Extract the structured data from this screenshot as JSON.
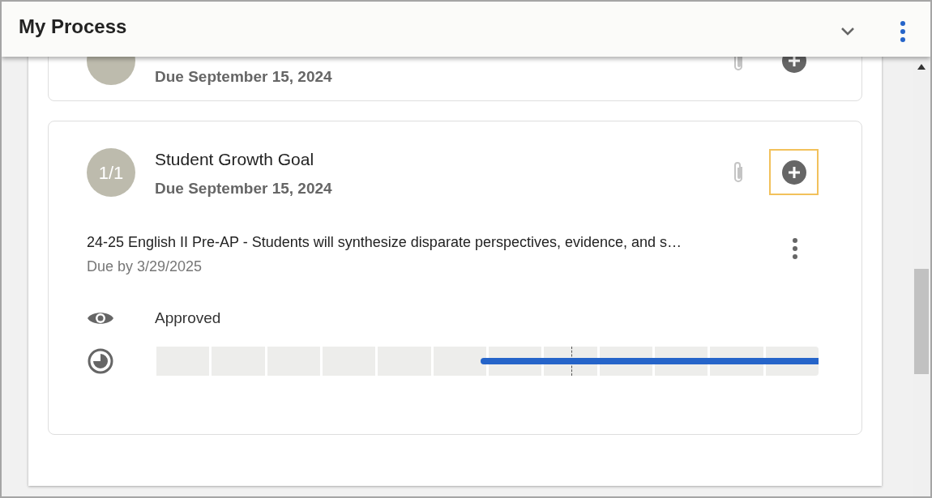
{
  "header": {
    "title": "My Process"
  },
  "tasks": [
    {
      "due": "Due September 15, 2024",
      "add_focused": false
    },
    {
      "badge": "1/1",
      "title": "Student Growth Goal",
      "due": "Due September 15, 2024",
      "add_focused": true,
      "goal": {
        "description": "24-25 English II Pre-AP - Students will synthesize disparate perspectives, evidence, and s…",
        "due": "Due by 3/29/2025",
        "status": "Approved",
        "progress": {
          "level": 0.51
        }
      }
    }
  ]
}
